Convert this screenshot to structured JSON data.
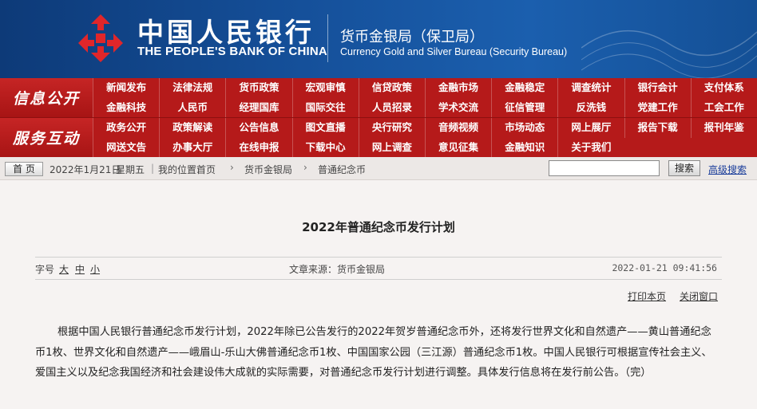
{
  "header": {
    "cn_name": "中国人民银行",
    "en_name": "THE PEOPLE'S BANK OF CHINA",
    "bureau_cn": "货币金银局（保卫局）",
    "bureau_en": "Currency  Gold and Silver Bureau (Security Bureau)",
    "brand_color": "#b51a1a",
    "header_color": "#15509a"
  },
  "nav": {
    "row1_label": "信息公开",
    "row1_items": [
      "新闻发布",
      "法律法规",
      "货币政策",
      "宏观审慎",
      "信贷政策",
      "金融市场",
      "金融稳定",
      "调查统计",
      "银行会计",
      "支付体系",
      "金融科技",
      "人民币",
      "经理国库",
      "国际交往",
      "人员招录",
      "学术交流",
      "征信管理",
      "反洗钱",
      "党建工作",
      "工会工作"
    ],
    "row2_label": "服务互动",
    "row2_items": [
      "政务公开",
      "政策解读",
      "公告信息",
      "图文直播",
      "央行研究",
      "音频视频",
      "市场动态",
      "网上展厅",
      "报告下载",
      "报刊年鉴",
      "网送文告",
      "办事大厅",
      "在线申报",
      "下载中心",
      "网上调查",
      "意见征集",
      "金融知识",
      "关于我们"
    ]
  },
  "crumb": {
    "home": "首 页",
    "date": "2022年1月21日",
    "weekday": "星期五",
    "sep": "|",
    "location_label": "我的位置:",
    "loc_home": "首页",
    "arrow": "›",
    "loc_1": "货币金银局",
    "loc_2": "普通纪念币",
    "search_value": "",
    "search_button": "搜索",
    "advanced_search": "高级搜索"
  },
  "article": {
    "title": "2022年普通纪念币发行计划",
    "font_size_label": "字号",
    "font_large": "大",
    "font_medium": "中",
    "font_small": "小",
    "source": "文章来源：货币金银局",
    "pub_time": "2022-01-21  09:41:56",
    "print": "打印本页",
    "close": "关闭窗口",
    "body": "根据中国人民银行普通纪念币发行计划，2022年除已公告发行的2022年贺岁普通纪念币外，还将发行世界文化和自然遗产——黄山普通纪念币1枚、世界文化和自然遗产——峨眉山-乐山大佛普通纪念币1枚、中国国家公园（三江源）普通纪念币1枚。中国人民银行可根据宣传社会主义、爱国主义以及纪念我国经济和社会建设伟大成就的实际需要，对普通纪念币发行计划进行调整。具体发行信息将在发行前公告。（完）"
  }
}
